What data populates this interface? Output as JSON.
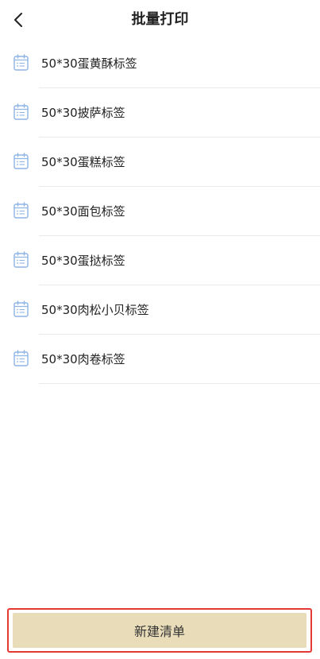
{
  "header": {
    "title": "批量打印",
    "back_icon": "chevron-left-icon"
  },
  "list": {
    "item_icon": "calendar-list-icon",
    "icon_color": "#8fb4e6",
    "items": [
      {
        "label": "50*30蛋黄酥标签"
      },
      {
        "label": "50*30披萨标签"
      },
      {
        "label": "50*30蛋糕标签"
      },
      {
        "label": "50*30面包标签"
      },
      {
        "label": "50*30蛋挞标签"
      },
      {
        "label": "50*30肉松小贝标签"
      },
      {
        "label": "50*30肉卷标签"
      }
    ]
  },
  "footer": {
    "new_list_label": "新建清单",
    "button_color": "#e9dcb9",
    "highlight_color": "#e53935"
  }
}
